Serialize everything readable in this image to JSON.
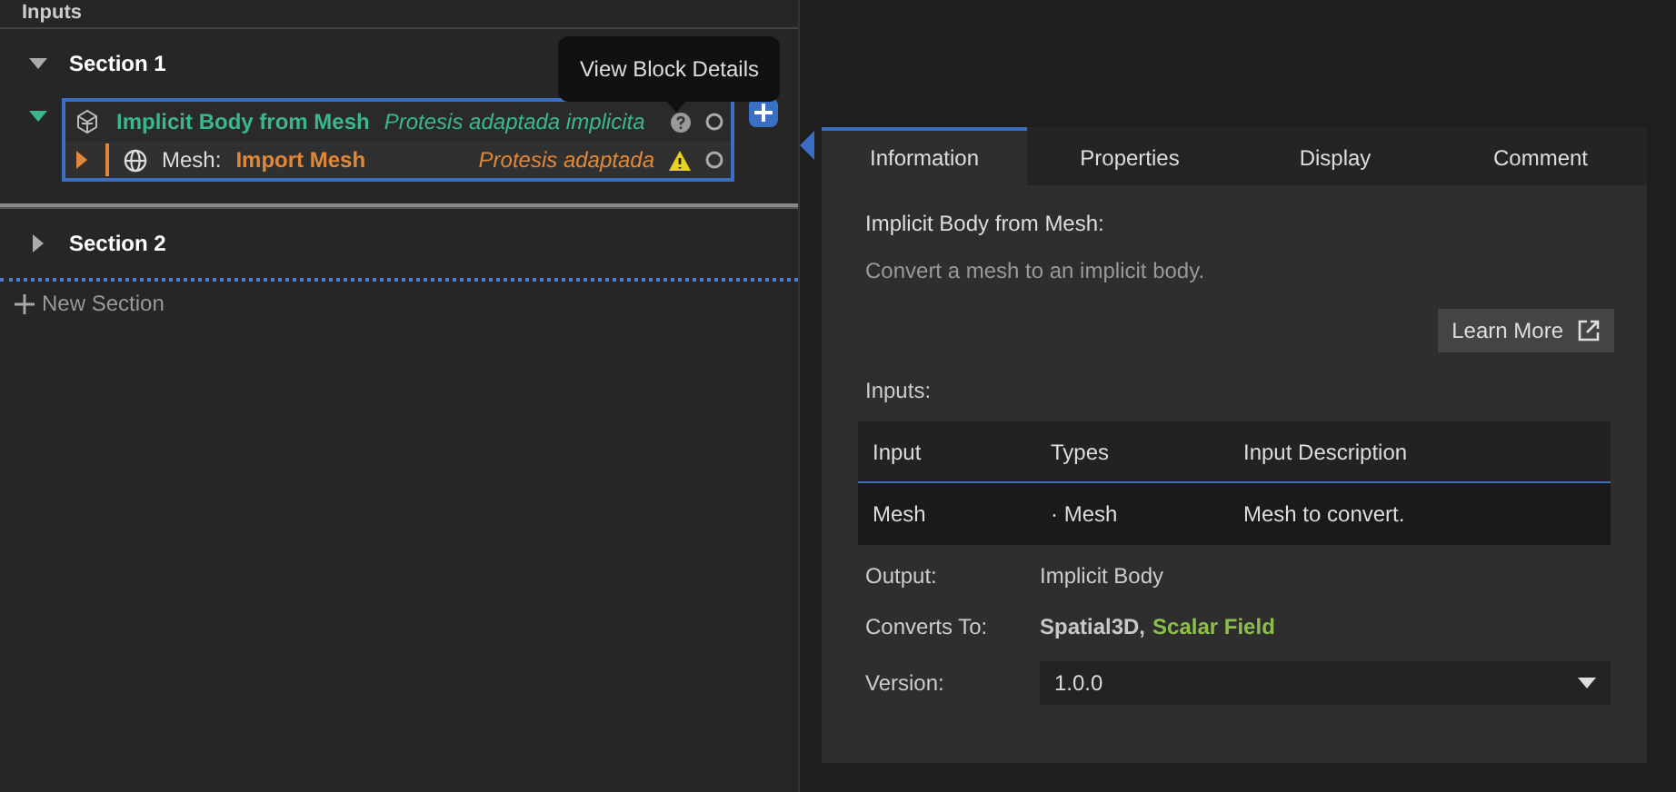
{
  "header": {
    "title": "Inputs"
  },
  "sections": [
    {
      "title": "Section 1",
      "expanded": true,
      "blocks": [
        {
          "name": "Implicit Body from Mesh",
          "alias": "Protesis adaptada implicita",
          "expanded": true,
          "inputs": [
            {
              "label": "Mesh:",
              "source": "Import Mesh",
              "alias": "Protesis adaptada",
              "warning": true,
              "expanded": false
            }
          ]
        }
      ]
    },
    {
      "title": "Section 2",
      "expanded": false
    }
  ],
  "new_section": {
    "label": "New Section"
  },
  "tooltip": {
    "text": "View Block Details"
  },
  "details": {
    "tabs": [
      {
        "label": "Information",
        "selected": true
      },
      {
        "label": "Properties",
        "selected": false
      },
      {
        "label": "Display",
        "selected": false
      },
      {
        "label": "Comment",
        "selected": false
      }
    ],
    "title": "Implicit Body from Mesh:",
    "description": "Convert a mesh to an implicit body.",
    "learn_more": "Learn More",
    "inputs_label": "Inputs:",
    "table": {
      "columns": [
        "Input",
        "Types",
        "Input Description"
      ],
      "rows": [
        [
          "Mesh",
          "· Mesh",
          "Mesh to convert."
        ]
      ]
    },
    "output_label": "Output:",
    "output": "Implicit Body",
    "converts_label": "Converts To:",
    "converts": [
      {
        "text": "Spatial3D,",
        "color": "#c8c8c8"
      },
      {
        "text": "Scalar Field",
        "color": "#8fbf4a"
      }
    ],
    "version_label": "Version:",
    "version": "1.0.0"
  }
}
